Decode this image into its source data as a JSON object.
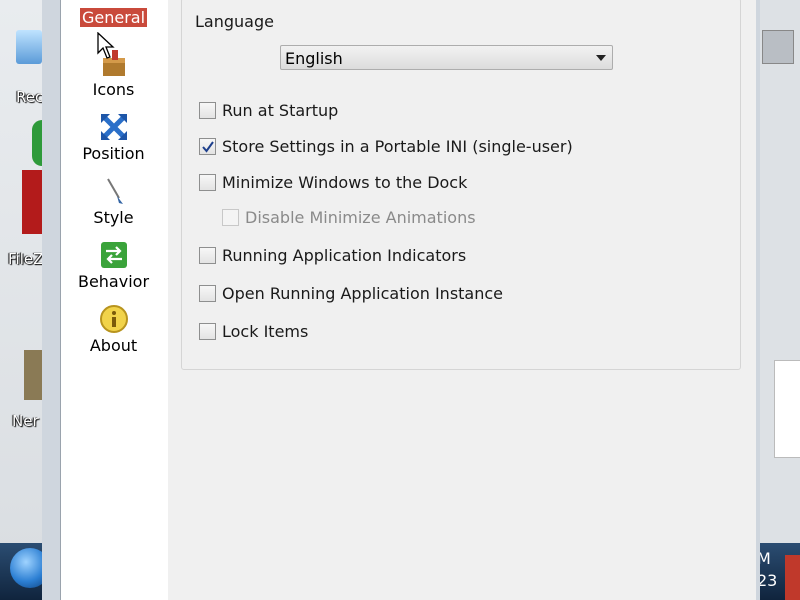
{
  "desktop": {
    "icons": [
      "Rec",
      "FileZ",
      "Ner"
    ],
    "clock_top": "M",
    "clock_bottom": "23"
  },
  "sidebar": {
    "items": [
      {
        "label": "General",
        "icon": "general-icon",
        "active": true
      },
      {
        "label": "Icons",
        "icon": "box-icon"
      },
      {
        "label": "Position",
        "icon": "position-arrows-icon"
      },
      {
        "label": "Style",
        "icon": "paintbrush-icon"
      },
      {
        "label": "Behavior",
        "icon": "behavior-icon"
      },
      {
        "label": "About",
        "icon": "info-icon"
      }
    ]
  },
  "general": {
    "language_label": "Language",
    "language_value": "English",
    "options": [
      {
        "label": "Run at Startup",
        "checked": false
      },
      {
        "label": "Store Settings in a Portable INI (single-user)",
        "checked": true
      },
      {
        "label": "Minimize Windows to the Dock",
        "checked": false
      },
      {
        "label": "Disable Minimize Animations",
        "checked": false,
        "disabled": true
      },
      {
        "label": "Running Application Indicators",
        "checked": false
      },
      {
        "label": "Open Running Application Instance",
        "checked": false
      },
      {
        "label": "Lock Items",
        "checked": false
      }
    ]
  },
  "colors": {
    "active_nav": "#c94a3b",
    "panel": "#f0f0f0"
  }
}
